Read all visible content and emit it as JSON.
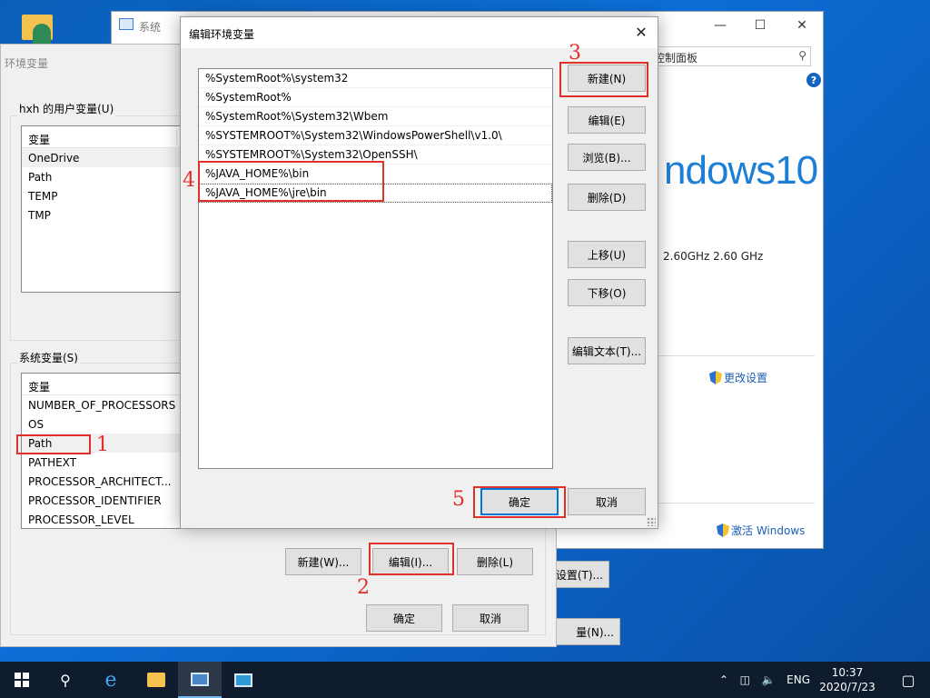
{
  "system_window": {
    "title": "系统",
    "search_placeholder": "控制面板",
    "help_label": "?",
    "win10_logo_text": "ndows10",
    "cpu_speed": "2.60GHz   2.60 GHz",
    "change_settings_link": "更改设置",
    "activate_windows_link": "激活 Windows",
    "partial_button_1": "设置(T)...",
    "partial_button_2": "量(N)..."
  },
  "env_dialog": {
    "title": "环境变量",
    "user_vars_label": "hxh 的用户变量(U)",
    "user_vars": {
      "column_header": "变量",
      "rows": [
        "OneDrive",
        "Path",
        "TEMP",
        "TMP"
      ]
    },
    "system_vars_label": "系统变量(S)",
    "system_vars": {
      "column_header": "变量",
      "rows": [
        "NUMBER_OF_PROCESSORS",
        "OS",
        "Path",
        "PATHEXT",
        "PROCESSOR_ARCHITECT...",
        "PROCESSOR_IDENTIFIER",
        "PROCESSOR_LEVEL"
      ]
    },
    "buttons": {
      "new": "新建(W)...",
      "edit": "编辑(I)...",
      "delete": "删除(L)",
      "ok": "确定",
      "cancel": "取消"
    }
  },
  "edit_dialog": {
    "title": "编辑环境变量",
    "close_glyph": "✕",
    "paths": [
      "%SystemRoot%\\system32",
      "%SystemRoot%",
      "%SystemRoot%\\System32\\Wbem",
      "%SYSTEMROOT%\\System32\\WindowsPowerShell\\v1.0\\",
      "%SYSTEMROOT%\\System32\\OpenSSH\\",
      "%JAVA_HOME%\\bin",
      "%JAVA_HOME%\\jre\\bin"
    ],
    "buttons": {
      "new": "新建(N)",
      "edit": "编辑(E)",
      "browse": "浏览(B)...",
      "delete": "删除(D)",
      "move_up": "上移(U)",
      "move_down": "下移(O)",
      "edit_text": "编辑文本(T)...",
      "ok": "确定",
      "cancel": "取消"
    }
  },
  "annotations": {
    "n1": "1",
    "n2": "2",
    "n3": "3",
    "n4": "4",
    "n5": "5"
  },
  "taskbar": {
    "tray_language": "ENG",
    "time": "10:37",
    "date": "2020/7/23"
  },
  "colors": {
    "annotation_red": "#e0302a",
    "accent_blue": "#0078d7",
    "taskbar_bg": "#0f1c2e"
  }
}
